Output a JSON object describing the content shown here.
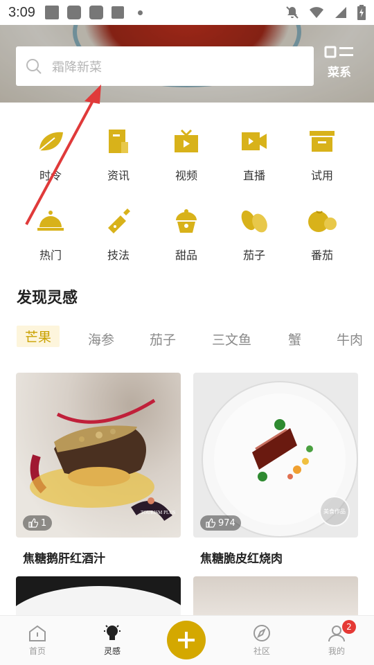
{
  "status_bar": {
    "time": "3:09",
    "icons": [
      "image-icon",
      "app-icon",
      "app-icon",
      "app-icon",
      "dot-icon",
      "mute-icon",
      "wifi-icon",
      "signal-icon",
      "battery-icon"
    ]
  },
  "search": {
    "placeholder": "霜降新菜"
  },
  "category_button": {
    "label": "菜系"
  },
  "grid": {
    "row1": [
      {
        "label": "时令",
        "icon": "leaf-icon"
      },
      {
        "label": "资讯",
        "icon": "news-icon"
      },
      {
        "label": "视频",
        "icon": "tv-icon"
      },
      {
        "label": "直播",
        "icon": "camera-icon"
      },
      {
        "label": "试用",
        "icon": "box-icon"
      }
    ],
    "row2": [
      {
        "label": "热门",
        "icon": "cloche-icon"
      },
      {
        "label": "技法",
        "icon": "cleaver-icon"
      },
      {
        "label": "甜品",
        "icon": "cupcake-icon"
      },
      {
        "label": "茄子",
        "icon": "eggplant-icon"
      },
      {
        "label": "番茄",
        "icon": "tomato-icon"
      }
    ]
  },
  "discover": {
    "title": "发现灵感",
    "tags": [
      "芒果",
      "海参",
      "茄子",
      "三文鱼",
      "蟹",
      "牛肉"
    ],
    "active_tag": "芒果"
  },
  "cards": [
    {
      "title": "焦糖鹅肝红酒汁",
      "likes": "1",
      "watermark": "TOURISM PLUS"
    },
    {
      "title": "焦糖脆皮红烧肉",
      "likes": "974",
      "stamp": "美食作品"
    }
  ],
  "bottom_nav": {
    "items": [
      {
        "label": "首页",
        "icon": "home-icon"
      },
      {
        "label": "灵感",
        "icon": "lightbulb-icon"
      },
      {
        "label": "",
        "icon": "plus-icon"
      },
      {
        "label": "社区",
        "icon": "compass-icon"
      },
      {
        "label": "我的",
        "icon": "user-icon"
      }
    ],
    "active": "灵感",
    "badge": "2"
  },
  "colors": {
    "accent": "#d4a800",
    "icon_gold": "#d8b21a",
    "annotation_arrow": "#e03a3a"
  }
}
